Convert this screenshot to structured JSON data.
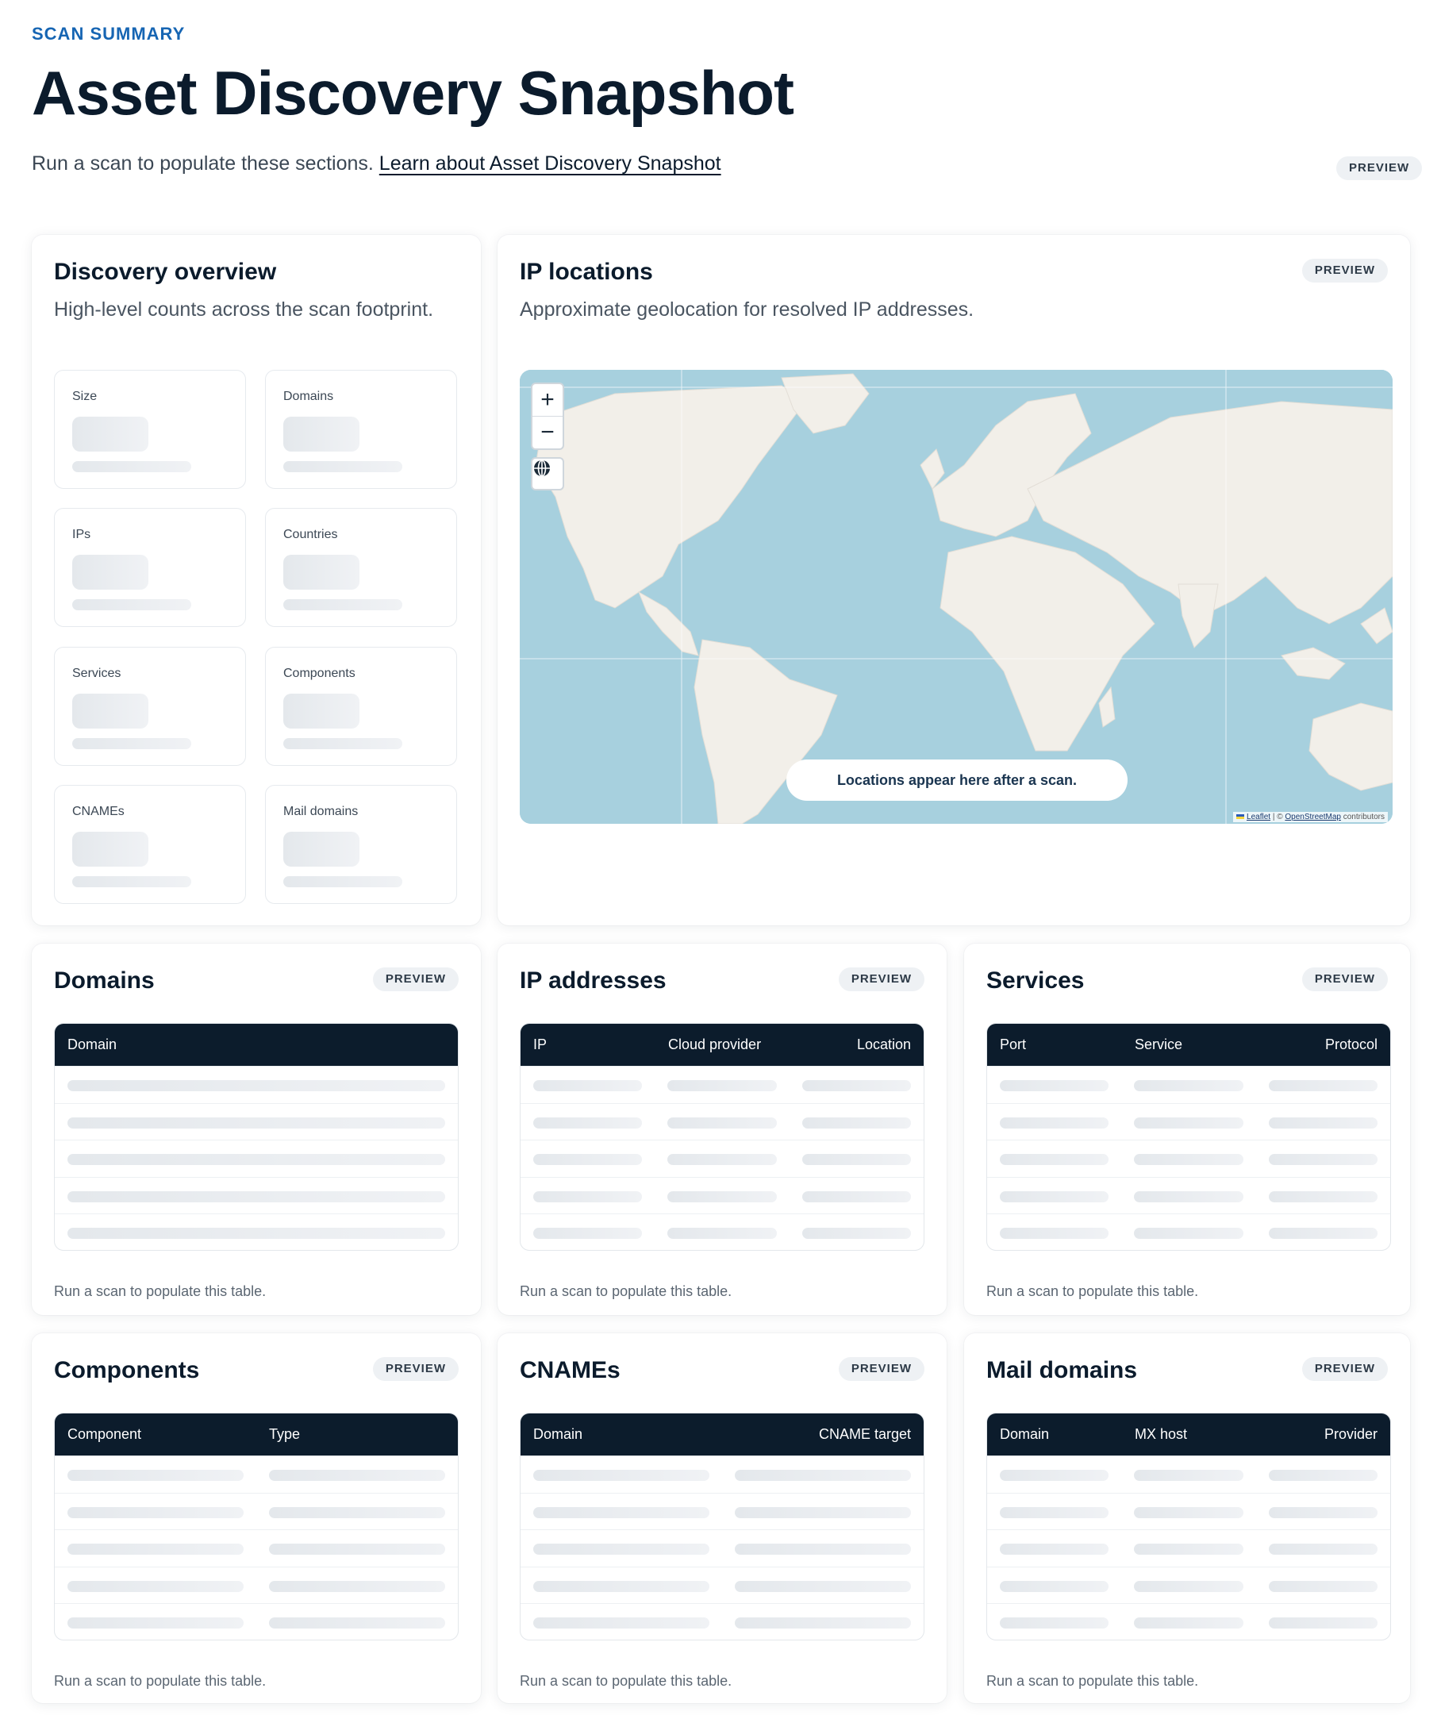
{
  "header": {
    "eyebrow": "SCAN SUMMARY",
    "title": "Asset Discovery Snapshot",
    "subtitle": "Run a scan to populate these sections.",
    "learn_link": "Learn about Asset Discovery Snapshot",
    "badge": "PREVIEW"
  },
  "overview": {
    "title": "Discovery overview",
    "desc": "High-level counts across the scan footprint.",
    "tiles": [
      "Size",
      "Domains",
      "IPs",
      "Countries",
      "Services",
      "Components",
      "CNAMEs",
      "Mail domains"
    ]
  },
  "ip_locations": {
    "title": "IP locations",
    "desc": "Approximate geolocation for resolved IP addresses.",
    "badge": "PREVIEW",
    "zoom_in": "+",
    "zoom_out": "−",
    "pill": "Locations appear here after a scan.",
    "attribution": {
      "leaflet": "Leaflet",
      "sep": " | © ",
      "osm": "OpenStreetMap",
      "tail": " contributors"
    }
  },
  "tables": {
    "domains": {
      "title": "Domains",
      "badge": "PREVIEW",
      "columns": [
        "Domain"
      ],
      "note": "Run a scan to populate this table."
    },
    "ip_addresses": {
      "title": "IP addresses",
      "badge": "PREVIEW",
      "columns": [
        "IP",
        "Cloud provider",
        "Location"
      ],
      "note": "Run a scan to populate this table."
    },
    "services": {
      "title": "Services",
      "badge": "PREVIEW",
      "columns": [
        "Port",
        "Service",
        "Protocol"
      ],
      "note": "Run a scan to populate this table."
    },
    "components": {
      "title": "Components",
      "badge": "PREVIEW",
      "columns": [
        "Component",
        "Type"
      ],
      "note": "Run a scan to populate this table."
    },
    "cnames": {
      "title": "CNAMEs",
      "badge": "PREVIEW",
      "columns": [
        "Domain",
        "CNAME target"
      ],
      "note": "Run a scan to populate this table."
    },
    "mail_domains": {
      "title": "Mail domains",
      "badge": "PREVIEW",
      "columns": [
        "Domain",
        "MX host",
        "Provider"
      ],
      "note": "Run a scan to populate this table."
    }
  },
  "colors": {
    "navy": "#0c1c2c",
    "accent": "#1665b3",
    "water": "#a7d0de",
    "land": "#f2efe9"
  }
}
